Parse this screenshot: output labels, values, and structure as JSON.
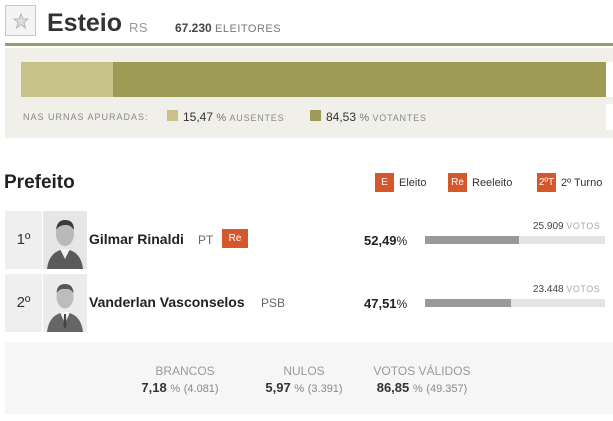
{
  "header": {
    "city": "Esteio",
    "state": "RS",
    "voters_count": "67.230",
    "voters_label": "ELEITORES"
  },
  "turnout": {
    "label": "NAS URNAS APURADAS:",
    "absent_pct": "15,47",
    "absent_label": "AUSENTES",
    "voters_pct": "84,53",
    "voters_label": "VOTANTES",
    "absent_fraction": 0.1547,
    "colors": {
      "absent": "#c7c28a",
      "voters": "#9d9b56"
    }
  },
  "office": {
    "title": "Prefeito",
    "legend": [
      {
        "badge": "E",
        "label": "Eleito"
      },
      {
        "badge": "Re",
        "label": "Reeleito"
      },
      {
        "badge": "2ºT",
        "label": "2º Turno"
      }
    ]
  },
  "candidates": [
    {
      "rank": "1º",
      "name": "Gilmar Rinaldi",
      "party": "PT",
      "status": "Re",
      "pct": "52,49",
      "pct_value": 52.49,
      "votes": "25.909",
      "votes_label": "VOTOS"
    },
    {
      "rank": "2º",
      "name": "Vanderlan Vasconselos",
      "party": "PSB",
      "status": "",
      "pct": "47,51",
      "pct_value": 47.51,
      "votes": "23.448",
      "votes_label": "VOTOS"
    }
  ],
  "summary": {
    "brancos": {
      "label": "BRANCOS",
      "pct": "7,18",
      "count": "(4.081)"
    },
    "nulos": {
      "label": "NULOS",
      "pct": "5,97",
      "count": "(3.391)"
    },
    "validos": {
      "label": "VOTOS VÁLIDOS",
      "pct": "86,85",
      "count": "(49.357)"
    }
  },
  "colors": {
    "accent": "#d5582d",
    "bar": "#999999"
  },
  "percent_sign": "%"
}
